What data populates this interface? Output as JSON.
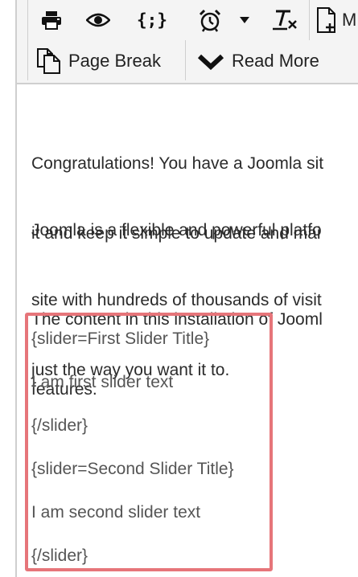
{
  "toolbar": {
    "row1": {
      "print_icon": "print-icon",
      "preview_icon": "eye-icon",
      "code_icon_text": "{;}",
      "clock_icon": "alarm-clock-icon",
      "dropdown_icon": "caret-down-icon",
      "clear_format_icon": "clear-formatting-icon",
      "new_doc_icon": "new-document-icon",
      "partial_label": "M"
    },
    "row2": {
      "page_break_label": "Page Break",
      "read_more_label": "Read More"
    }
  },
  "content": {
    "para1": [
      "Congratulations! You have a Joomla sit",
      "it and keep it simple to update and mai"
    ],
    "para2": [
      "Joomla is a flexible and powerful platfo",
      "site with hundreds of thousands of visit",
      "just the way you want it to."
    ],
    "para3": [
      "The content in this installation of Jooml",
      "features."
    ],
    "sliders": [
      "{slider=First Slider Title}",
      "I am first slider text",
      "{/slider}",
      "{slider=Second Slider Title}",
      "I am second slider text",
      "{/slider}"
    ]
  },
  "colors": {
    "highlight_border": "#e6757a",
    "toolbar_bg": "#f4f4f4",
    "text": "#2b2b2b",
    "slider_text": "#555555"
  }
}
